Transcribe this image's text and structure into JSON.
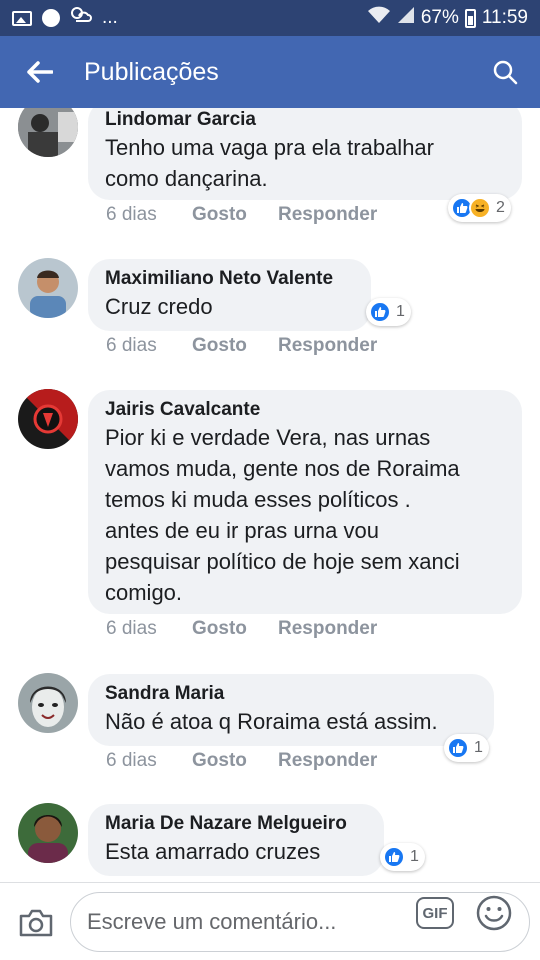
{
  "status_bar": {
    "battery": "67%",
    "time": "11:59",
    "ellipsis": "..."
  },
  "app_bar": {
    "title": "Publicações"
  },
  "comments": [
    {
      "author": "Lindomar Garcia",
      "lines": [
        "Tenho uma vaga pra ela trabalhar",
        "como dançarina."
      ],
      "time": "6 dias",
      "like": "Gosto",
      "reply": "Responder",
      "reaction_count": "2",
      "reactions": [
        "like",
        "haha"
      ]
    },
    {
      "author": "Maximiliano Neto Valente",
      "lines": [
        "Cruz credo"
      ],
      "time": "6 dias",
      "like": "Gosto",
      "reply": "Responder",
      "reaction_count": "1",
      "reactions": [
        "like"
      ]
    },
    {
      "author": "Jairis Cavalcante",
      "lines": [
        "Pior ki e verdade Vera, nas urnas",
        "vamos muda, gente nos de Roraima",
        "temos ki muda esses políticos .",
        "antes de eu ir pras urna vou",
        "pesquisar político de hoje sem xanci",
        "comigo."
      ],
      "time": "6 dias",
      "like": "Gosto",
      "reply": "Responder"
    },
    {
      "author": "Sandra Maria",
      "lines": [
        "Não é  atoa q Roraima está assim."
      ],
      "time": "6 dias",
      "like": "Gosto",
      "reply": "Responder",
      "reaction_count": "1",
      "reactions": [
        "like"
      ]
    },
    {
      "author": "Maria De Nazare Melgueiro",
      "lines": [
        "Esta amarrado cruzes"
      ],
      "reaction_count": "1",
      "reactions": [
        "like"
      ]
    }
  ],
  "composer": {
    "placeholder": "Escreve um comentário...",
    "gif_label": "GIF"
  },
  "colors": {
    "brand": "#4267b2",
    "status": "#2d4373",
    "like": "#1877f2"
  }
}
